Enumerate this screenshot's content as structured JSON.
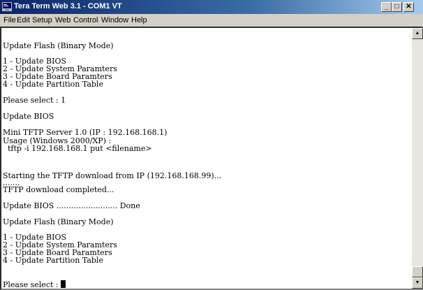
{
  "window": {
    "title": "Tera Term Web 3.1 - COM1 VT",
    "minimize_glyph": "_",
    "maximize_glyph": "□",
    "close_glyph": "✕"
  },
  "menu": {
    "items": [
      "File",
      "Edit",
      "Setup",
      "Web",
      "Control",
      "Window",
      "Help"
    ]
  },
  "terminal": {
    "lines": [
      "Update Flash (Binary Mode)",
      "1 - Update BIOS",
      "2 - Update System Paramters",
      "3 - Update Board Paramters",
      "4 - Update Partition Table",
      "Please select : 1",
      "Update BIOS",
      "Mini TFTP Server 1.0 (IP : 192.168.168.1)",
      "Usage (Windows 2000/XP) :",
      "  tftp -i 192.168.168.1 put <filename>",
      "Starting the TFTP download from IP (192.168.168.99)...",
      ".......",
      "TFTP download completed...",
      "Update BIOS ......................... Done",
      "Update Flash (Binary Mode)",
      "1 - Update BIOS",
      "2 - Update System Paramters",
      "3 - Update Board Paramters",
      "4 - Update Partition Table",
      "Please select : "
    ]
  },
  "scrollbar": {
    "up_glyph": "▲",
    "down_glyph": "▼"
  }
}
